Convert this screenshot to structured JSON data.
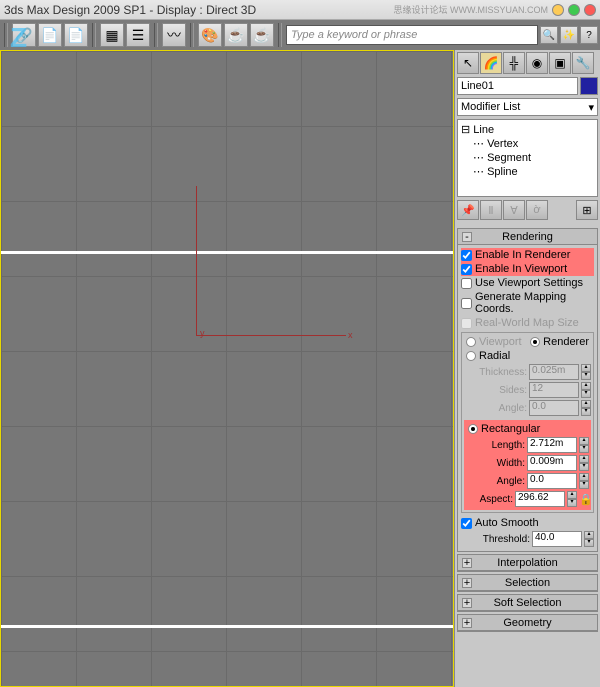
{
  "title": "3ds Max Design 2009 SP1      - Display : Direct 3D",
  "watermark": "思缘设计论坛 WWW.MISSYUAN.COM",
  "search": {
    "placeholder": "Type a keyword or phrase"
  },
  "panel": {
    "object_name": "Line01",
    "modifier_list": "Modifier List",
    "tree": {
      "root": "Line",
      "sub": [
        "Vertex",
        "Segment",
        "Spline"
      ]
    }
  },
  "rendering": {
    "title": "Rendering",
    "enable_renderer": "Enable In Renderer",
    "enable_viewport": "Enable In Viewport",
    "use_viewport": "Use Viewport Settings",
    "gen_mapping": "Generate Mapping Coords.",
    "real_world": "Real-World Map Size",
    "viewport": "Viewport",
    "renderer": "Renderer",
    "radial": "Radial",
    "thickness_l": "Thickness:",
    "thickness_v": "0.025m",
    "sides_l": "Sides:",
    "sides_v": "12",
    "angle_l": "Angle:",
    "angle_v": "0.0",
    "rectangular": "Rectangular",
    "length_l": "Length:",
    "length_v": "2.712m",
    "width_l": "Width:",
    "width_v": "0.009m",
    "angle2_l": "Angle:",
    "angle2_v": "0.0",
    "aspect_l": "Aspect:",
    "aspect_v": "296.62",
    "auto_smooth": "Auto Smooth",
    "threshold_l": "Threshold:",
    "threshold_v": "40.0"
  },
  "rollouts": [
    "Interpolation",
    "Selection",
    "Soft Selection",
    "Geometry"
  ],
  "axis": {
    "x": "x",
    "y": "y"
  }
}
